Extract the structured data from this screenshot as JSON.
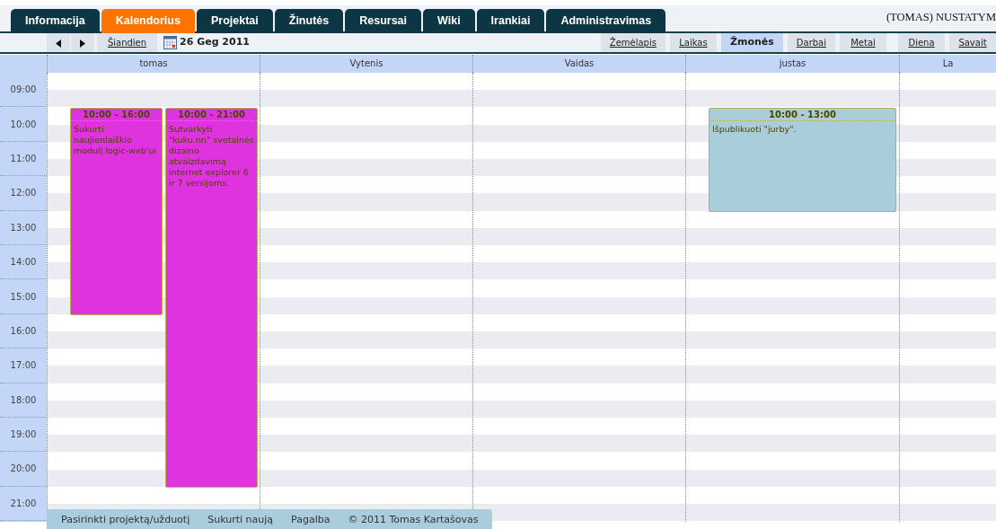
{
  "tabs": [
    {
      "label": "Informacija",
      "selected": false
    },
    {
      "label": "Kalendorius",
      "selected": true
    },
    {
      "label": "Projektai",
      "selected": false
    },
    {
      "label": "Žinutės",
      "selected": false
    },
    {
      "label": "Resursai",
      "selected": false
    },
    {
      "label": "Wiki",
      "selected": false
    },
    {
      "label": "Irankiai",
      "selected": false
    },
    {
      "label": "Administravimas",
      "selected": false
    }
  ],
  "user_label": "(TOMAS) NUSTATYM",
  "toolbar": {
    "today": "Šiandien",
    "date": "26 Geg 2011",
    "views": [
      {
        "label": "Žemėlapis",
        "selected": false
      },
      {
        "label": "Laikas",
        "selected": false
      },
      {
        "label": "Žmonės",
        "selected": true
      },
      {
        "label": "Darbai",
        "selected": false
      },
      {
        "label": "Metai",
        "selected": false
      }
    ],
    "periods": [
      {
        "label": "Diena",
        "selected": false
      },
      {
        "label": "Savait",
        "selected": false
      }
    ]
  },
  "time_slots": [
    "09:00",
    "10:00",
    "11:00",
    "12:00",
    "13:00",
    "14:00",
    "15:00",
    "16:00",
    "17:00",
    "18:00",
    "19:00",
    "20:00",
    "21:00"
  ],
  "columns": [
    {
      "name": "tomas",
      "events": [
        {
          "time": "10:00 - 16:00",
          "text": "Sukurti naujienlaiškio modulį logic-web'ui",
          "color": "#e033e0"
        },
        {
          "time": "10:00 - 21:00",
          "text": "Sutvarkyti \"kuku.nn\" svetainės dizaino atvaizdavimą internet explorer 6 ir 7 versijoms.",
          "color": "#e033e0"
        }
      ]
    },
    {
      "name": "Vytenis"
    },
    {
      "name": "Vaidas"
    },
    {
      "name": "justas",
      "events": [
        {
          "time": "10:00 - 13:00",
          "text": "Išpublikuoti \"jurby\".",
          "color": "#aacddc"
        }
      ]
    },
    {
      "name": "La"
    }
  ],
  "footer": {
    "links": [
      "Pasirinkti projektą/užduotį",
      "Sukurti naują",
      "Pagalba"
    ],
    "copyright": "© 2011 Tomas Kartašovas"
  }
}
